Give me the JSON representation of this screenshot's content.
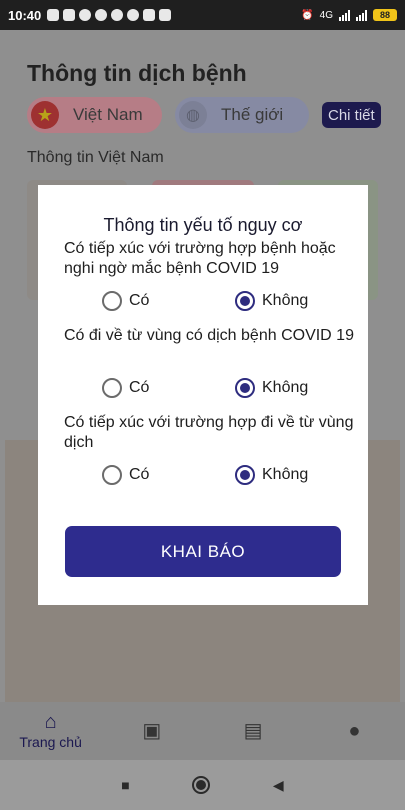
{
  "status": {
    "time": "10:40",
    "network": "4G",
    "battery": "88"
  },
  "app": {
    "title": "Thông tin dịch bệnh",
    "tabs": [
      {
        "label": "Việt Nam"
      },
      {
        "label": "Thế giới"
      }
    ],
    "detail_button": "Chi tiết",
    "section_title": "Thông tin Việt Nam"
  },
  "modal": {
    "title": "Thông tin yếu tố nguy cơ",
    "questions": [
      {
        "text": "Có tiếp xúc với trường hợp bệnh hoặc nghi ngờ mắc bệnh COVID 19",
        "yes": "Có",
        "no": "Không",
        "selected": "Không"
      },
      {
        "text": "Có đi về từ vùng có dịch bệnh COVID 19",
        "yes": "Có",
        "no": "Không",
        "selected": "Không"
      },
      {
        "text": "Có tiếp xúc với trường hợp đi về từ vùng dịch",
        "yes": "Có",
        "no": "Không",
        "selected": "Không"
      }
    ],
    "submit_label": "KHAI BÁO"
  },
  "bottom_nav": [
    {
      "label": "Trang chủ",
      "icon": "home-icon"
    },
    {
      "label": "",
      "icon": "image-icon"
    },
    {
      "label": "",
      "icon": "chat-icon"
    },
    {
      "label": "",
      "icon": "person-icon"
    }
  ],
  "colors": {
    "primary": "#2e2c8e",
    "dark_navy": "#1b1850"
  }
}
